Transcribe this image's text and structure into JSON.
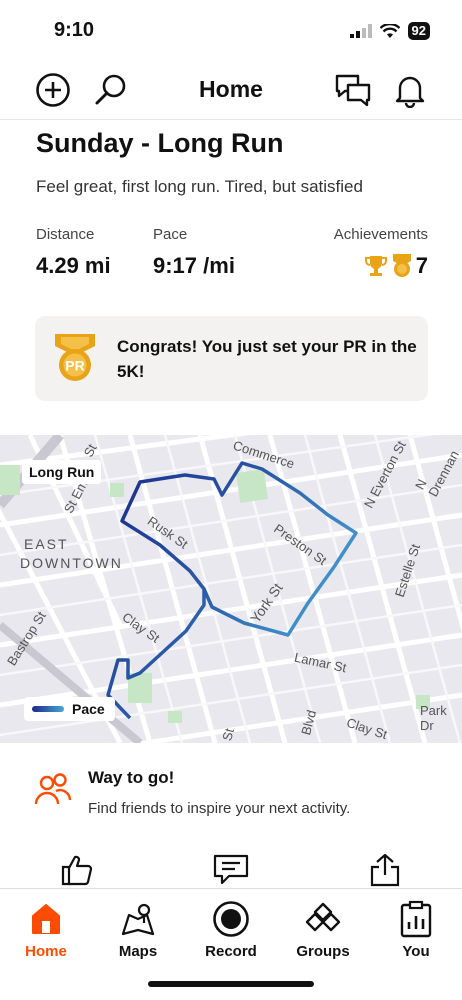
{
  "status_bar": {
    "time": "9:10",
    "battery": "92"
  },
  "header": {
    "title": "Home"
  },
  "activity": {
    "title": "Sunday - Long Run",
    "description": "Feel great, first long run. Tired, but satisfied",
    "stats": {
      "distance_label": "Distance",
      "distance_value": "4.29 mi",
      "pace_label": "Pace",
      "pace_value": "9:17 /mi",
      "achievements_label": "Achievements",
      "achievements_count": "7"
    },
    "pr_message": "Congrats! You just set your PR in the 5K!",
    "pr_badge": "PR"
  },
  "map": {
    "badge": "Long Run",
    "legend": "Pace",
    "labels": {
      "east_downtown_1": "EAST",
      "east_downtown_2": "DOWNTOWN",
      "rusk": "Rusk St",
      "preston": "Preston St",
      "york": "York St",
      "clay_1": "Clay St",
      "clay_2": "Clay St",
      "lamar": "Lamar St",
      "bastrop": "Bastrop St",
      "st_emanuel": "St Em",
      "commerce": "Commerce",
      "n_everton": "N Everton St",
      "n_drennan": "N Drennan",
      "estelle": "Estelle St",
      "park": "Park Dr",
      "st_fragment": "St",
      "blvd_fragment": "Blvd",
      "st_fragment_2": "St"
    }
  },
  "suggestion": {
    "title": "Way to go!",
    "subtitle": "Find friends to inspire your next activity."
  },
  "tabs": [
    {
      "label": "Home",
      "active": true
    },
    {
      "label": "Maps",
      "active": false
    },
    {
      "label": "Record",
      "active": false
    },
    {
      "label": "Groups",
      "active": false
    },
    {
      "label": "You",
      "active": false
    }
  ],
  "colors": {
    "accent": "#fc4c02",
    "gold": "#e8a317",
    "route_dark": "#1a2a8a",
    "route_light": "#4aa6d6",
    "card_bg": "#f3f2f0"
  },
  "icons": [
    "add-icon",
    "search-icon",
    "chat-icon",
    "bell-icon",
    "trophy-icon",
    "medal-icon",
    "friends-icon",
    "thumbs-up-icon",
    "comment-icon",
    "share-icon",
    "home-icon",
    "maps-icon",
    "record-icon",
    "groups-icon",
    "you-icon"
  ]
}
